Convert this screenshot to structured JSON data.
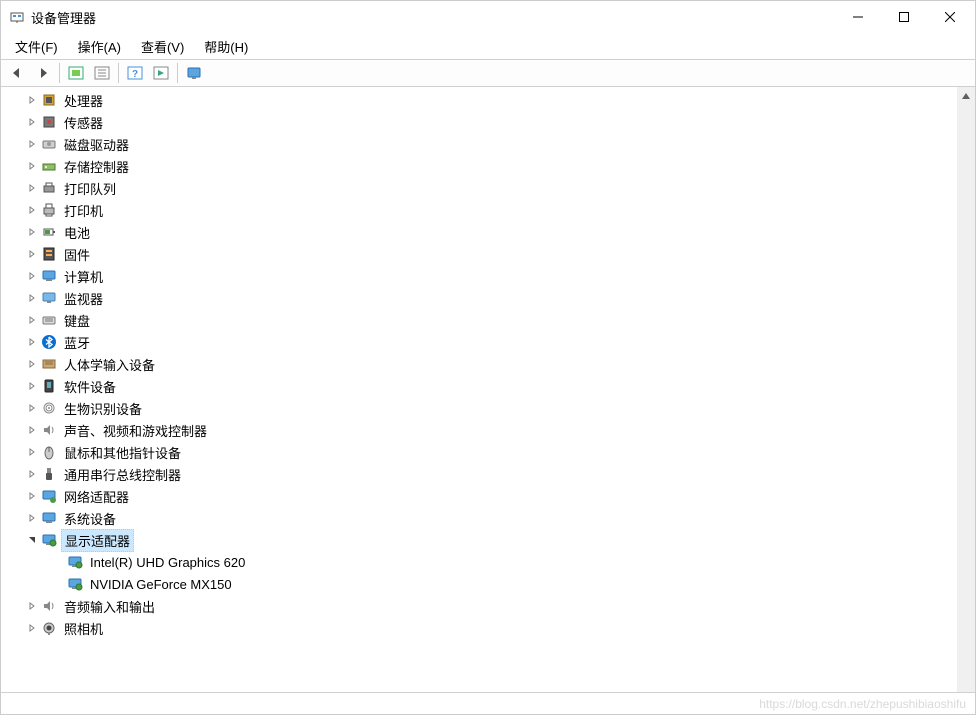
{
  "window": {
    "title": "设备管理器"
  },
  "menu": {
    "file": "文件(F)",
    "action": "操作(A)",
    "view": "查看(V)",
    "help": "帮助(H)"
  },
  "tree": {
    "items": [
      {
        "label": "处理器",
        "icon": "cpu"
      },
      {
        "label": "传感器",
        "icon": "sensor"
      },
      {
        "label": "磁盘驱动器",
        "icon": "disk"
      },
      {
        "label": "存储控制器",
        "icon": "storage"
      },
      {
        "label": "打印队列",
        "icon": "print-queue"
      },
      {
        "label": "打印机",
        "icon": "printer"
      },
      {
        "label": "电池",
        "icon": "battery"
      },
      {
        "label": "固件",
        "icon": "firmware"
      },
      {
        "label": "计算机",
        "icon": "computer"
      },
      {
        "label": "监视器",
        "icon": "monitor"
      },
      {
        "label": "键盘",
        "icon": "keyboard"
      },
      {
        "label": "蓝牙",
        "icon": "bluetooth"
      },
      {
        "label": "人体学输入设备",
        "icon": "hid"
      },
      {
        "label": "软件设备",
        "icon": "software"
      },
      {
        "label": "生物识别设备",
        "icon": "biometric"
      },
      {
        "label": "声音、视频和游戏控制器",
        "icon": "sound"
      },
      {
        "label": "鼠标和其他指针设备",
        "icon": "mouse"
      },
      {
        "label": "通用串行总线控制器",
        "icon": "usb"
      },
      {
        "label": "网络适配器",
        "icon": "network"
      },
      {
        "label": "系统设备",
        "icon": "system"
      },
      {
        "label": "显示适配器",
        "icon": "display",
        "expanded": true,
        "selected": true,
        "children": [
          {
            "label": "Intel(R) UHD Graphics 620",
            "icon": "display-card"
          },
          {
            "label": "NVIDIA GeForce MX150",
            "icon": "display-card"
          }
        ]
      },
      {
        "label": "音频输入和输出",
        "icon": "audio"
      },
      {
        "label": "照相机",
        "icon": "camera"
      }
    ]
  },
  "watermark": "https://blog.csdn.net/zhepushibiaoshifu"
}
